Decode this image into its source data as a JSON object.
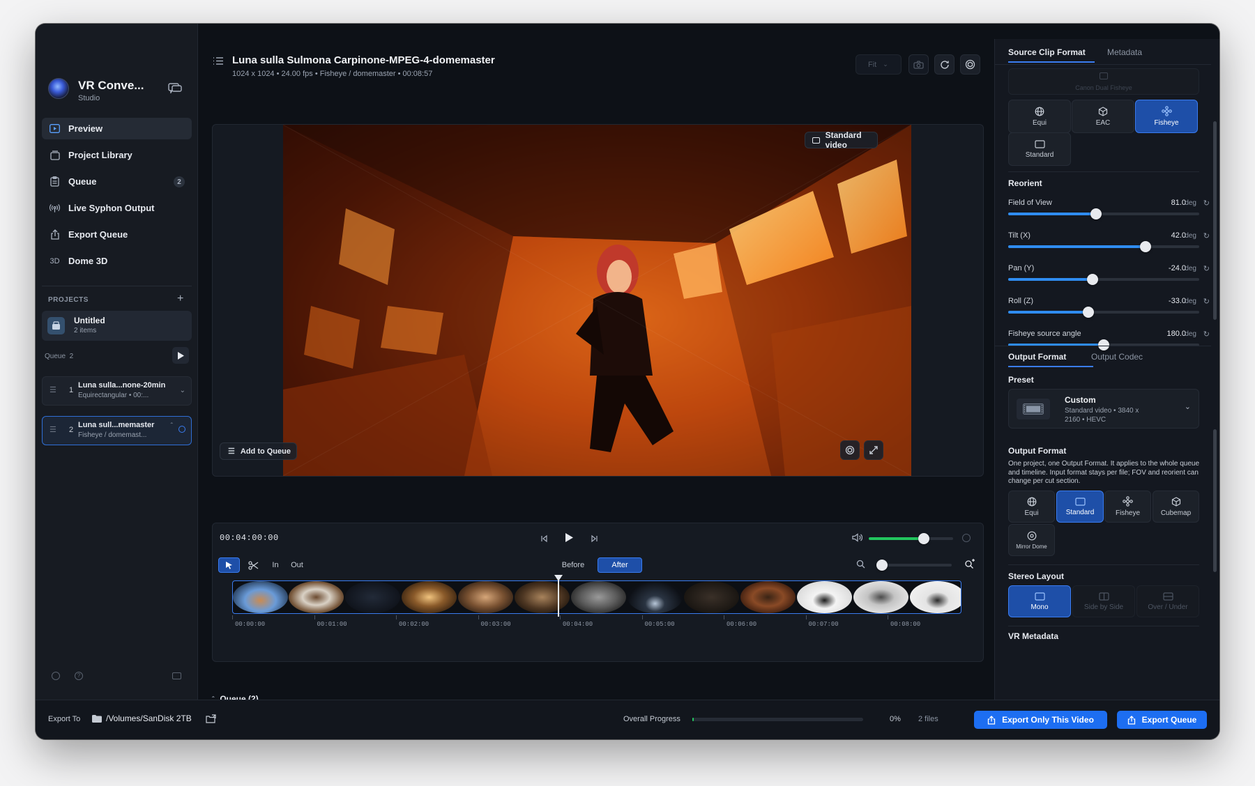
{
  "app": {
    "title": "VR Conve...",
    "subtitle": "Studio"
  },
  "sidebar": {
    "nav": [
      {
        "label": "Preview",
        "icon": "play-icon"
      },
      {
        "label": "Project Library",
        "icon": "library-icon"
      },
      {
        "label": "Queue",
        "icon": "clipboard-icon",
        "badge": "2"
      },
      {
        "label": "Live Syphon Output",
        "icon": "broadcast-icon"
      },
      {
        "label": "Export Queue",
        "icon": "export-icon"
      },
      {
        "label": "Dome 3D",
        "icon": "3d-icon",
        "icon_text": "3D"
      }
    ],
    "projects_heading": "PROJECTS",
    "project": {
      "name": "Untitled",
      "count": "2 items"
    },
    "queue_label": "Queue",
    "queue_count": "2",
    "queue_items": [
      {
        "num": "1",
        "title": "Luna sulla...none-20min",
        "sub": "Equirectangular  •  00:..."
      },
      {
        "num": "2",
        "title": "Luna sull...memaster",
        "sub": "Fisheye / domemast..."
      }
    ]
  },
  "header": {
    "title": "Luna sulla Sulmona Carpinone-MPEG-4-domemaster",
    "meta": "1024 x 1024  •  24.00 fps  •  Fisheye / domemaster  •  00:08:57",
    "fit_label": "Fit"
  },
  "preview": {
    "standard_video_label": "Standard video",
    "add_to_queue_label": "Add to Queue"
  },
  "transport": {
    "timecode": "00:04:00:00",
    "in_label": "In",
    "out_label": "Out",
    "before_label": "Before",
    "after_label": "After",
    "volume": 0.65,
    "zoom": 0.0,
    "playhead_fraction": 0.446,
    "ticks": [
      "00:00:00",
      "00:01:00",
      "00:02:00",
      "00:03:00",
      "00:04:00",
      "00:05:00",
      "00:06:00",
      "00:07:00",
      "00:08:00"
    ]
  },
  "queue_footer": {
    "label": "Queue (2)"
  },
  "right_panel": {
    "tabs": [
      "Source Clip Format",
      "Metadata"
    ],
    "canon_label": "Canon Dual Fisheye",
    "source_formats": [
      {
        "label": "Equi",
        "icon": "globe-icon"
      },
      {
        "label": "EAC",
        "icon": "cube-icon"
      },
      {
        "label": "Fisheye",
        "icon": "fisheye-icon",
        "selected": true
      },
      {
        "label": "Standard",
        "icon": "rectangle-icon"
      }
    ],
    "reorient_heading": "Reorient",
    "sliders": [
      {
        "label": "Field of View",
        "value": "81.0",
        "unit": "deg",
        "fraction": 0.46
      },
      {
        "label": "Tilt (X)",
        "value": "42.0",
        "unit": "deg",
        "fraction": 0.72
      },
      {
        "label": "Pan (Y)",
        "value": "-24.0",
        "unit": "deg",
        "fraction": 0.44
      },
      {
        "label": "Roll (Z)",
        "value": "-33.0",
        "unit": "deg",
        "fraction": 0.42
      },
      {
        "label": "Fisheye source angle",
        "value": "180.0",
        "unit": "deg",
        "fraction": 0.5
      }
    ],
    "output_tabs": [
      "Output Format",
      "Output Codec"
    ],
    "preset_heading": "Preset",
    "preset": {
      "name": "Custom",
      "desc": "Standard video  •  3840 x 2160  •  HEVC"
    },
    "output_format_heading": "Output Format",
    "output_format_desc": "One project, one Output Format. It applies to the whole queue and timeline. Input format stays per file; FOV and reorient can change per cut section.",
    "output_formats": [
      {
        "label": "Equi",
        "icon": "globe-icon"
      },
      {
        "label": "Standard",
        "icon": "rectangle-icon",
        "selected": true
      },
      {
        "label": "Fisheye",
        "icon": "fisheye-icon"
      },
      {
        "label": "Cubemap",
        "icon": "cube-icon"
      },
      {
        "label": "Mirror Dome",
        "icon": "mirror-dome-icon"
      }
    ],
    "stereo_heading": "Stereo Layout",
    "stereo": [
      {
        "label": "Mono",
        "selected": true
      },
      {
        "label": "Side by Side"
      },
      {
        "label": "Over / Under"
      }
    ],
    "vr_metadata_heading": "VR Metadata"
  },
  "bottom": {
    "export_to_label": "Export To",
    "export_path": "/Volumes/SanDisk 2TB",
    "overall_progress_label": "Overall Progress",
    "progress_value": 0.01,
    "progress_text": "0%",
    "files_text": "2 files",
    "export_only_label": "Export Only This Video",
    "export_queue_label": "Export Queue"
  },
  "colors": {
    "accent": "#1d6ef2",
    "background": "#0d1117",
    "panel": "#141820",
    "slider_fill": "#2f8cf0",
    "progress": "#22c55e"
  }
}
